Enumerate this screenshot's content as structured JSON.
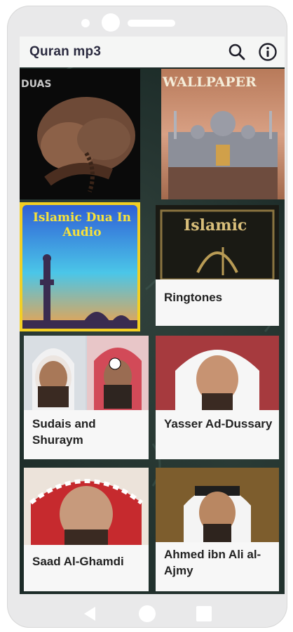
{
  "app": {
    "title": "Quran mp3"
  },
  "actions": {
    "search_icon": "search-icon",
    "info_icon": "info-icon"
  },
  "tiles": [
    {
      "id": "duas",
      "label": "",
      "overlay": "DUAS"
    },
    {
      "id": "wallpaper",
      "label": "",
      "overlay": "WALLPAPER"
    },
    {
      "id": "islamic-dua-audio",
      "label": "",
      "overlay": "Islamic Dua In Audio"
    },
    {
      "id": "ringtones",
      "label": "Ringtones",
      "overlay": "Islamic"
    },
    {
      "id": "sudais",
      "label": "Sudais and Shuraym",
      "overlay": ""
    },
    {
      "id": "yasser",
      "label": "Yasser Ad-Dussary",
      "overlay": ""
    },
    {
      "id": "saad",
      "label": "Saad Al-Ghamdi",
      "overlay": ""
    },
    {
      "id": "ajmy",
      "label": "Ahmed ibn Ali al-Ajmy",
      "overlay": ""
    }
  ],
  "navigation": {
    "back": "back-triangle-icon",
    "home": "home-circle-icon",
    "recents": "recents-square-icon"
  },
  "colors": {
    "app_bar": "#f5f6f5",
    "title_text": "#2b2b40",
    "screen_background": "#1b2a27",
    "tile_background": "#f7f7f7",
    "frame": "#e9e9ea"
  }
}
